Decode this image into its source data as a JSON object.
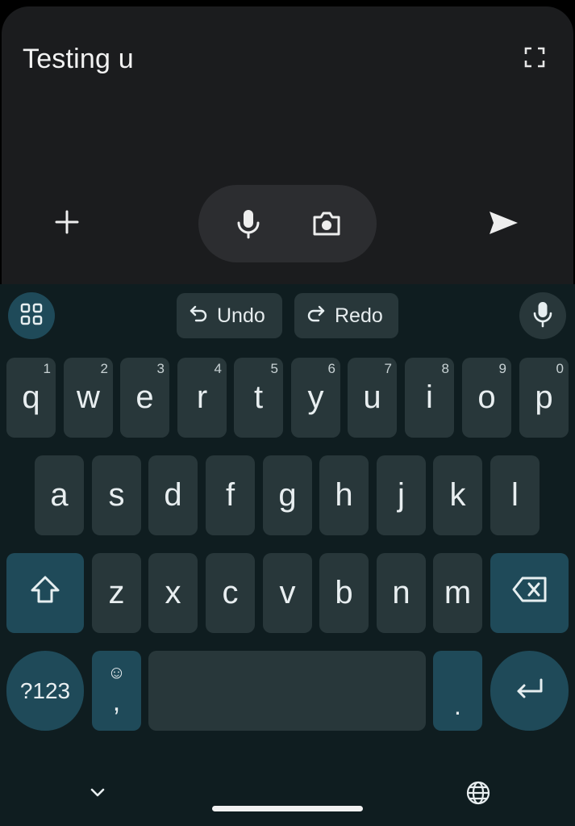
{
  "compose": {
    "text": "Testing u",
    "icons": {
      "expand": "expand-icon",
      "add": "plus-icon",
      "mic": "mic-icon",
      "camera": "camera-icon",
      "send": "send-icon"
    }
  },
  "toolbar": {
    "undo_label": "Undo",
    "redo_label": "Redo",
    "icons": {
      "apps": "grid-icon",
      "undo": "undo-icon",
      "redo": "redo-icon",
      "mic": "mic-icon"
    }
  },
  "keyboard": {
    "row1": [
      {
        "key": "q",
        "hint": "1"
      },
      {
        "key": "w",
        "hint": "2"
      },
      {
        "key": "e",
        "hint": "3"
      },
      {
        "key": "r",
        "hint": "4"
      },
      {
        "key": "t",
        "hint": "5"
      },
      {
        "key": "y",
        "hint": "6"
      },
      {
        "key": "u",
        "hint": "7"
      },
      {
        "key": "i",
        "hint": "8"
      },
      {
        "key": "o",
        "hint": "9"
      },
      {
        "key": "p",
        "hint": "0"
      }
    ],
    "row2": [
      "a",
      "s",
      "d",
      "f",
      "g",
      "h",
      "j",
      "k",
      "l"
    ],
    "row3": [
      "z",
      "x",
      "c",
      "v",
      "b",
      "n",
      "m"
    ],
    "symbols_label": "?123",
    "comma_label": ",",
    "emoji_hint": "☺",
    "period_label": ".",
    "special_icons": {
      "shift": "shift-icon",
      "backspace": "backspace-icon",
      "enter": "enter-icon"
    }
  },
  "nav": {
    "icons": {
      "hide": "chevron-down-icon",
      "language": "globe-icon"
    }
  },
  "colors": {
    "keyboard_bg": "#0f1d20",
    "key_bg": "#28373a",
    "accent_key_bg": "#1f4a59",
    "compose_bg": "#1b1c1e"
  }
}
